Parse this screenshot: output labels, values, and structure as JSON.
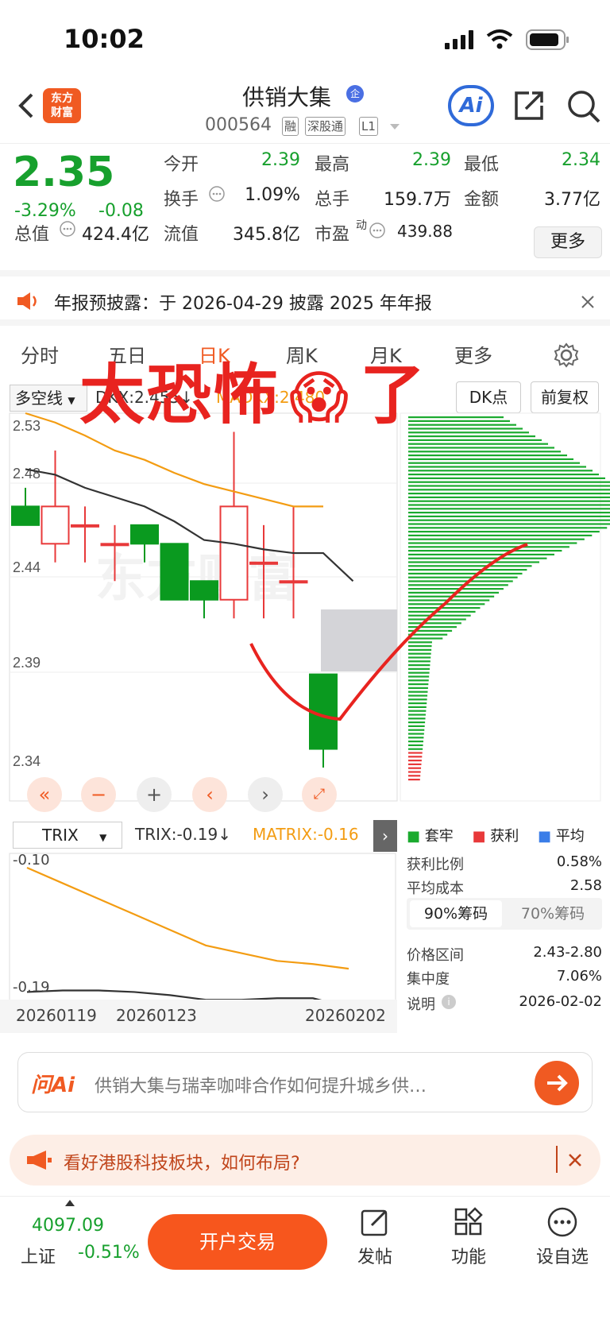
{
  "status": {
    "time": "10:02"
  },
  "header": {
    "logo_line1": "东方",
    "logo_line2": "财富",
    "stock_name": "供销大集",
    "badge": "企",
    "stock_code": "000564",
    "tags": [
      "融",
      "深股通",
      "L1"
    ],
    "ai_label": "Ai"
  },
  "quote": {
    "price": "2.35",
    "change_pct": "-3.29%",
    "change_abs": "-0.08",
    "open_label": "今开",
    "open": "2.39",
    "high_label": "最高",
    "high": "2.39",
    "low_label": "最低",
    "low": "2.34",
    "turnover_label": "换手",
    "turnover": "1.09%",
    "volume_label": "总手",
    "volume": "159.7万",
    "amount_label": "金额",
    "amount": "3.77亿",
    "mcap_label": "总值",
    "mcap": "424.4亿",
    "float_label": "流值",
    "float": "345.8亿",
    "pe_label": "市盈",
    "pe_sup": "动",
    "pe": "439.88",
    "more": "更多"
  },
  "notice": {
    "text": "年报预披露：于 2026-04-29 披露 2025 年年报"
  },
  "tabs": [
    "分时",
    "五日",
    "日K",
    "周K",
    "月K",
    "更多"
  ],
  "active_tab": 2,
  "kline": {
    "indicator": "多空线",
    "dkx": "DKX:2.455↓",
    "madkx": "MADKX:2.480",
    "dk_btn": "DK点",
    "adjust_btn": "前复权",
    "y_labels": [
      "2.53",
      "2.48",
      "2.44",
      "2.39",
      "2.34"
    ],
    "watermark": "东方财富"
  },
  "overlay": {
    "text1": "太恐怖",
    "text2": "了",
    "emoji": "😱"
  },
  "chart_data": {
    "type": "candlestick",
    "ylim": [
      2.34,
      2.53
    ],
    "candles": [
      {
        "o": 2.48,
        "h": 2.49,
        "l": 2.47,
        "c": 2.47
      },
      {
        "o": 2.46,
        "h": 2.51,
        "l": 2.45,
        "c": 2.48
      },
      {
        "o": 2.47,
        "h": 2.48,
        "l": 2.45,
        "c": 2.47
      },
      {
        "o": 2.46,
        "h": 2.47,
        "l": 2.44,
        "c": 2.46
      },
      {
        "o": 2.47,
        "h": 2.47,
        "l": 2.45,
        "c": 2.46
      },
      {
        "o": 2.46,
        "h": 2.46,
        "l": 2.43,
        "c": 2.43
      },
      {
        "o": 2.44,
        "h": 2.44,
        "l": 2.42,
        "c": 2.43
      },
      {
        "o": 2.43,
        "h": 2.52,
        "l": 2.42,
        "c": 2.48
      },
      {
        "o": 2.45,
        "h": 2.47,
        "l": 2.42,
        "c": 2.45
      },
      {
        "o": 2.44,
        "h": 2.48,
        "l": 2.42,
        "c": 2.44
      },
      {
        "o": 2.39,
        "h": 2.39,
        "l": 2.34,
        "c": 2.35
      }
    ],
    "dkx": [
      2.5,
      2.497,
      2.49,
      2.485,
      2.48,
      2.472,
      2.462,
      2.46,
      2.457,
      2.455,
      2.455,
      2.44
    ],
    "madkx": [
      2.53,
      2.525,
      2.518,
      2.51,
      2.505,
      2.498,
      2.492,
      2.488,
      2.484,
      2.48,
      2.48
    ],
    "trix": {
      "ylim": [
        -0.19,
        -0.1
      ],
      "trix": [
        -0.18,
        -0.179,
        -0.179,
        -0.18,
        -0.182,
        -0.185,
        -0.185,
        -0.184,
        -0.184,
        -0.19
      ],
      "matrix": [
        -0.1,
        -0.11,
        -0.12,
        -0.13,
        -0.14,
        -0.15,
        -0.155,
        -0.16,
        -0.162,
        -0.165
      ]
    },
    "chip_colors": {
      "lock": "#1aaa2e",
      "profit": "#e8393a",
      "avg": "#3a7de8"
    }
  },
  "trix": {
    "indicator": "TRIX",
    "trix_val": "TRIX:-0.19↓",
    "matrix_val": "MATRIX:-0.16",
    "y_top": "-0.10",
    "y_bottom": "-0.19",
    "dates": [
      "20260119",
      "20260123",
      "20260202"
    ]
  },
  "chip": {
    "legend": [
      "套牢",
      "获利",
      "平均"
    ],
    "profit_ratio_label": "获利比例",
    "profit_ratio": "0.58%",
    "avg_cost_label": "平均成本",
    "avg_cost": "2.58",
    "tab90": "90%筹码",
    "tab70": "70%筹码",
    "range_label": "价格区间",
    "range": "2.43-2.80",
    "concentration_label": "集中度",
    "concentration": "7.06%",
    "note_label": "说明",
    "date": "2026-02-02"
  },
  "askai": {
    "brand": "问Ai",
    "placeholder": "供销大集与瑞幸咖啡合作如何提升城乡供…"
  },
  "promo": {
    "text": "看好港股科技板块，如何布局?"
  },
  "bottom": {
    "index_val": "4097.09",
    "index_name": "上证",
    "index_chg": "-0.51%",
    "trade": "开户交易",
    "post": "发帖",
    "functions": "功能",
    "watch": "设自选"
  }
}
